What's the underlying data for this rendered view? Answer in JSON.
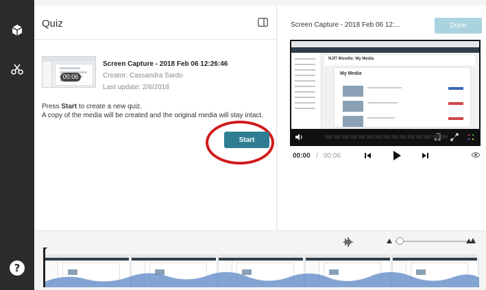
{
  "sidebar": {
    "items": [
      {
        "icon": "cube-icon",
        "label": ""
      },
      {
        "icon": "scissors-icon",
        "label": ""
      }
    ],
    "help_label": "?"
  },
  "quiz_panel": {
    "title": "Quiz",
    "entry": {
      "title": "Screen Capture - 2018 Feb 06 12:26:46",
      "creator": "Creator: Cassandra Sardo",
      "last_update": "Last update: 2/6/2018",
      "duration": "00:06"
    },
    "instructions": {
      "line1_prefix": "Press ",
      "line1_bold": "Start",
      "line1_suffix": " to create a new quiz.",
      "line2": "A copy of the media will be created and the original media will stay intact."
    },
    "start_label": "Start"
  },
  "player_panel": {
    "title": "Screen Capture - 2018 Feb 06 12:...",
    "done_label": "Done",
    "preview": {
      "page_heading": "NJIT Moodle: My Media",
      "card_title": "My Media"
    },
    "current_time": "00:00",
    "separator": "/",
    "total_time": "00:06"
  },
  "timeline": {
    "frame_count": 5
  },
  "colors": {
    "sidebar": "#2b2b2b",
    "accent": "#2f7d92",
    "done_disabled": "#a9d3de",
    "highlight_ring": "#d01a1a",
    "waveform": "#5b86c4"
  }
}
